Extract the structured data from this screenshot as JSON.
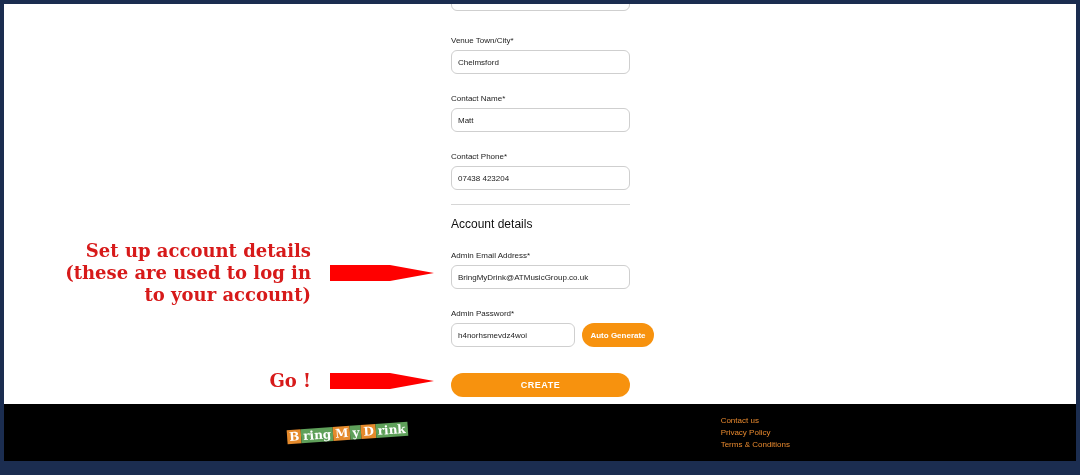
{
  "form": {
    "fields": [
      {
        "kind": "partial"
      },
      {
        "kind": "text",
        "label": "Venue Town/City*",
        "value": "Chelmsford"
      },
      {
        "kind": "text",
        "label": "Contact Name*",
        "value": "Matt"
      },
      {
        "kind": "text",
        "label": "Contact Phone*",
        "value": "07438 423204"
      }
    ],
    "section_title": "Account details",
    "account_fields": [
      {
        "kind": "text",
        "label": "Admin Email Address*",
        "value": "BringMyDrink@ATMusicGroup.co.uk",
        "annotation": "Set up account details (these are used to log in to your account)"
      },
      {
        "kind": "text",
        "label": "Admin Password*",
        "value": "h4norhsmevdz4woi",
        "button": "Auto Generate"
      }
    ],
    "submit": {
      "label": "CREATE",
      "annotation": "Go !"
    }
  },
  "footer": {
    "logo": [
      {
        "text": "B",
        "color": "#e58a2c"
      },
      {
        "text": "ring",
        "color": "#5fa05a"
      },
      {
        "text": "M",
        "color": "#e58a2c"
      },
      {
        "text": "y",
        "color": "#5fa05a"
      },
      {
        "text": "D",
        "color": "#e58a2c"
      },
      {
        "text": "rink",
        "color": "#5fa05a"
      }
    ],
    "links": [
      "Contact us",
      "Privacy Policy",
      "Terms & Conditions"
    ]
  }
}
